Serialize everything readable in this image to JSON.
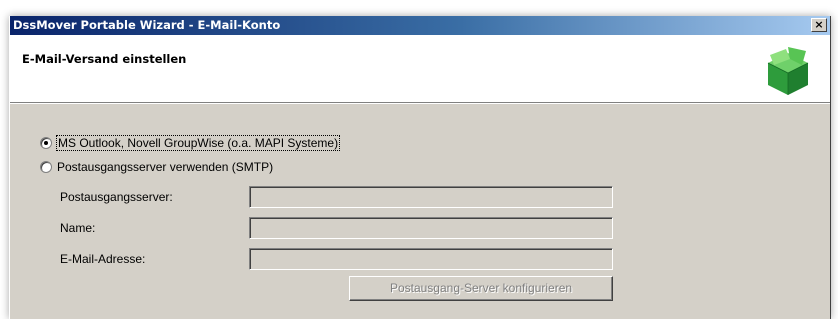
{
  "window": {
    "title": "DssMover Portable Wizard - E-Mail-Konto",
    "close_label": "×"
  },
  "header": {
    "title": "E-Mail-Versand einstellen",
    "icon": "green-box-icon"
  },
  "options": {
    "mapi": {
      "label": "MS Outlook, Novell GroupWise (o.a. MAPI Systeme)",
      "selected": true
    },
    "smtp": {
      "label": "Postausgangsserver verwenden (SMTP)",
      "selected": false
    }
  },
  "fields": {
    "server": {
      "label": "Postausgangsserver:",
      "value": ""
    },
    "name": {
      "label": "Name:",
      "value": ""
    },
    "email": {
      "label": "E-Mail-Adresse:",
      "value": ""
    }
  },
  "buttons": {
    "configure": {
      "label": "Postausgang-Server konfigurieren",
      "enabled": false
    }
  },
  "colors": {
    "titlebar_start": "#0a246a",
    "titlebar_end": "#a6caf0",
    "dialog_face": "#d4d0c8",
    "icon_green": "#3cb34a"
  }
}
